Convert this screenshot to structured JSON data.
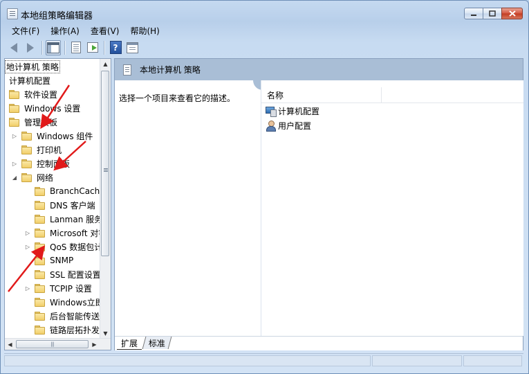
{
  "window": {
    "title": "本地组策略编辑器"
  },
  "menu": [
    {
      "label": "文件(F)"
    },
    {
      "label": "操作(A)"
    },
    {
      "label": "查看(V)"
    },
    {
      "label": "帮助(H)"
    }
  ],
  "tree": {
    "items": [
      {
        "label": "地计算机 策略",
        "indent": 0,
        "expander": "",
        "folder": false,
        "selected": true
      },
      {
        "label": "计算机配置",
        "indent": 0,
        "expander": "",
        "folder": false
      },
      {
        "label": "软件设置",
        "indent": 0,
        "expander": "",
        "folder": true
      },
      {
        "label": "Windows 设置",
        "indent": 0,
        "expander": "",
        "folder": true
      },
      {
        "label": "管理模板",
        "indent": 0,
        "expander": "",
        "folder": true
      },
      {
        "label": "Windows 组件",
        "indent": 1,
        "expander": "▷",
        "folder": true
      },
      {
        "label": "打印机",
        "indent": 1,
        "expander": "",
        "folder": true
      },
      {
        "label": "控制面板",
        "indent": 1,
        "expander": "▷",
        "folder": true
      },
      {
        "label": "网络",
        "indent": 1,
        "expander": "◢",
        "folder": true
      },
      {
        "label": "BranchCache",
        "indent": 2,
        "expander": "",
        "folder": true
      },
      {
        "label": "DNS 客户端",
        "indent": 2,
        "expander": "",
        "folder": true
      },
      {
        "label": "Lanman 服务器",
        "indent": 2,
        "expander": "",
        "folder": true
      },
      {
        "label": "Microsoft 对等",
        "indent": 2,
        "expander": "▷",
        "folder": true
      },
      {
        "label": "QoS 数据包计划",
        "indent": 2,
        "expander": "▷",
        "folder": true
      },
      {
        "label": "SNMP",
        "indent": 2,
        "expander": "",
        "folder": true
      },
      {
        "label": "SSL 配置设置",
        "indent": 2,
        "expander": "",
        "folder": true
      },
      {
        "label": "TCPIP 设置",
        "indent": 2,
        "expander": "▷",
        "folder": true
      },
      {
        "label": "Windows立即连接",
        "indent": 2,
        "expander": "",
        "folder": true
      },
      {
        "label": "后台智能传送服务",
        "indent": 2,
        "expander": "",
        "folder": true
      },
      {
        "label": "链路层拓扑发现",
        "indent": 2,
        "expander": "",
        "folder": true
      }
    ]
  },
  "details": {
    "header_title": "本地计算机 策略",
    "description": "选择一个项目来查看它的描述。",
    "column_name": "名称",
    "items": [
      {
        "label": "计算机配置",
        "icon": "computer-icon"
      },
      {
        "label": "用户配置",
        "icon": "user-icon"
      }
    ],
    "tabs": [
      {
        "label": "扩展"
      },
      {
        "label": "标准"
      }
    ]
  },
  "colors": {
    "window_frame": "#c5d9f0",
    "header_band": "#a9bed6",
    "annotation_arrow": "#e11a1a"
  }
}
